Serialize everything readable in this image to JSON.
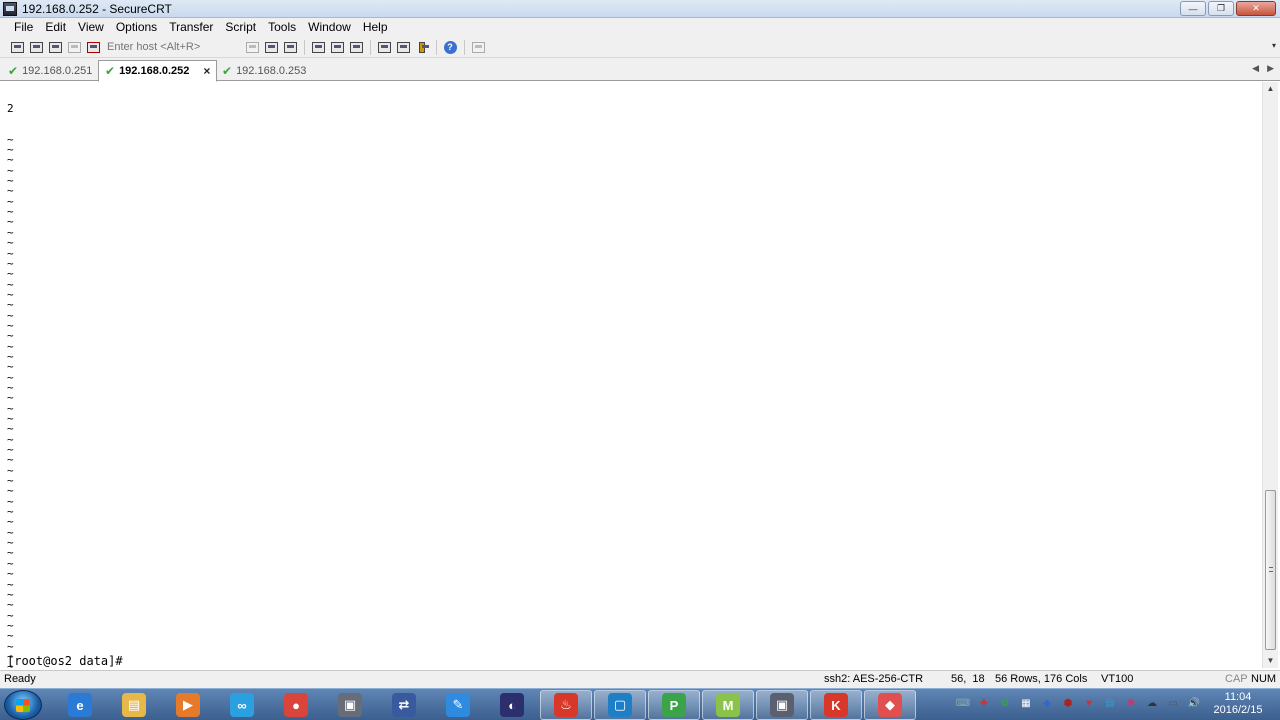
{
  "window": {
    "title": "192.168.0.252 - SecureCRT",
    "controls": {
      "minimize": "—",
      "maximize": "❐",
      "close": "✕"
    }
  },
  "menu": [
    "File",
    "Edit",
    "View",
    "Options",
    "Transfer",
    "Script",
    "Tools",
    "Window",
    "Help"
  ],
  "toolbar": {
    "host_placeholder": "Enter host <Alt+R>",
    "icons_left": [
      "connect-icon",
      "quick-connect-icon",
      "connect-in-tab-icon",
      "reconnect-icon",
      "disconnect-icon"
    ],
    "icons_mid": [
      "copy-icon",
      "paste-icon",
      "find-icon"
    ],
    "icons_right": [
      "print-icon",
      "print-selection-icon",
      "print-setup-icon",
      "session-options-icon",
      "global-options-icon",
      "keymap-icon"
    ],
    "help_symbol": "?",
    "overflow": "▾"
  },
  "tabs": [
    {
      "label": "192.168.0.251",
      "status": "✔",
      "active": false
    },
    {
      "label": "192.168.0.252",
      "status": "✔",
      "active": true,
      "close": "×"
    },
    {
      "label": "192.168.0.253",
      "status": "✔",
      "active": false
    }
  ],
  "tab_scroll": {
    "left": "◀",
    "right": "▶"
  },
  "terminal": {
    "first_line": "2",
    "filler": "~",
    "filler_count": 54,
    "prompt": "[root@os2 data]#"
  },
  "scrollbar": {
    "up": "▲",
    "down": "▼",
    "position_fraction": 0.87
  },
  "status": {
    "state": "Ready",
    "cipher": "ssh2: AES-256-CTR",
    "cursor_pos": "56,  18",
    "size": "56 Rows, 176 Cols",
    "emulation": "VT100",
    "caps": "CAP",
    "num": "NUM"
  },
  "taskbar": {
    "apps": [
      {
        "name": "ie",
        "glyph": "e",
        "color": "#2b7bd6"
      },
      {
        "name": "file-explorer",
        "glyph": "▤",
        "color": "#e6b84a"
      },
      {
        "name": "media-player",
        "glyph": "▶",
        "color": "#e57a2a"
      },
      {
        "name": "baidu-cloud",
        "glyph": "∞",
        "color": "#2aa0e0"
      },
      {
        "name": "chrome",
        "glyph": "●",
        "color": "#d9453a"
      },
      {
        "name": "securecrt-app",
        "glyph": "▣",
        "color": "#666c78"
      },
      {
        "name": "securefx-app",
        "glyph": "⇄",
        "color": "#3a5aa0"
      },
      {
        "name": "feather-app",
        "glyph": "✎",
        "color": "#2f8be0"
      },
      {
        "name": "eclipse",
        "glyph": "◐",
        "color": "#2c2f6e"
      },
      {
        "name": "red-app",
        "glyph": "♨",
        "color": "#d8382a"
      },
      {
        "name": "virtualbox",
        "glyph": "▢",
        "color": "#1f7fc6"
      },
      {
        "name": "pycharm",
        "glyph": "P",
        "color": "#3ba34a"
      },
      {
        "name": "m-app",
        "glyph": "M",
        "color": "#8bc34a"
      },
      {
        "name": "securecrt-window",
        "glyph": "▣",
        "color": "#5a6070"
      },
      {
        "name": "wps-app",
        "glyph": "K",
        "color": "#d8382a"
      },
      {
        "name": "eraser-app",
        "glyph": "◆",
        "color": "#e05050"
      }
    ],
    "tray": [
      "⌨",
      "✚",
      "⚙",
      "▦",
      "◆",
      "⬢",
      "♥",
      "▤",
      "❋",
      "☁",
      "▭",
      "🔊"
    ],
    "time": "11:04",
    "date": "2016/2/15"
  }
}
